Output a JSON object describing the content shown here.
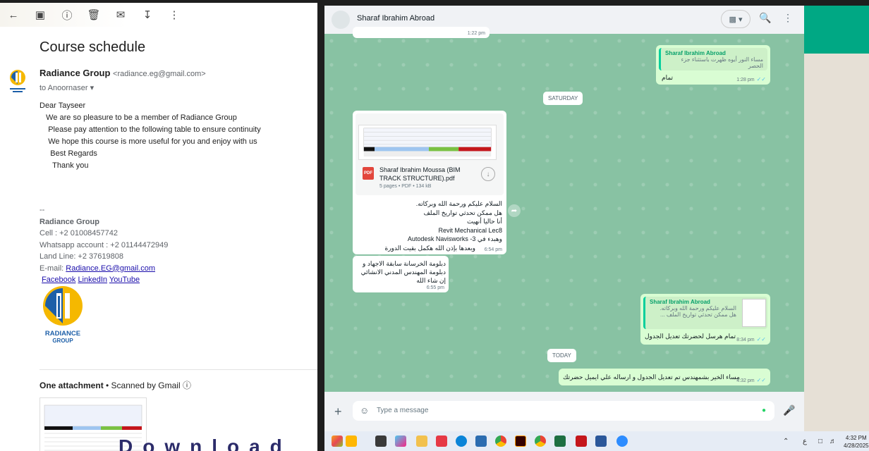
{
  "gmail": {
    "subject": "Course schedule",
    "sender_name": "Radiance Group",
    "sender_email": "<radiance.eg@gmail.com>",
    "to": "to Anoornaser",
    "body": [
      "Dear Tayseer",
      "",
      "   We are so pleasure to be a member of Radiance Group",
      "    Please pay attention to the following table to ensure continuity",
      "    We hope this course is more useful for you and enjoy with us",
      "",
      "     Best Regards",
      "      Thank you"
    ],
    "signature": {
      "dashes": "--",
      "name": "Radiance Group",
      "cell": "Cell : +2 01008457742",
      "whatsapp": "Whatsapp account : +2 01144472949",
      "landline": "Land Line: +2 37619808",
      "email_label": "E-mail: ",
      "email": "Radiance.EG@gmail.com",
      "links": [
        "Facebook",
        "LinkedIn",
        "YouTube"
      ]
    },
    "logo_text": [
      "RADIANCE",
      "GROUP"
    ],
    "attachment_title": "One attachment",
    "attachment_scanned": " • Scanned by Gmail",
    "download_text": "Download"
  },
  "whatsapp": {
    "contact_name": "Sharaf Ibrahim Abroad",
    "top_partial_time": "1:22 pm",
    "messages": {
      "m1": {
        "quote_name": "Sharaf Ibrahim Abroad",
        "quote_text": "مساء النور أيوه ظهرت باستثناء جزء الحصر",
        "text": "تمام",
        "time": "1:28 pm"
      },
      "day1": "SATURDAY",
      "pdf": {
        "name": "Sharaf Ibrahim Moussa (BIM TRACK STRUCTURE).pdf",
        "meta": "5 pages • PDF • 134 kB",
        "lines": [
          "السلام عليكم ورحمة الله وبركاته.",
          "هل ممكن تحدثي تواريخ الملف",
          "أنا حاليا أنهيت",
          "Revit Mechanical Lec8",
          "وهبدء في 3- Autodesk Navisworks",
          "وبعدها بإذن الله هكمل بقيت الدورة"
        ],
        "time": "6:54 pm"
      },
      "m2": {
        "lines": [
          "دبلومة الخرسانة سابقة الاجهاد و",
          "دبلومة المهندس المدني الانشائي",
          "إن شاء الله"
        ],
        "time": "6:55 pm"
      },
      "m3": {
        "quote_name": "Sharaf Ibrahim Abroad",
        "quote_lines": [
          "السلام عليكم ورحمة الله وبركاته.",
          "هل ممكن تحدثي تواريخ الملف ..."
        ],
        "text": "تمام هرسل لحضرتك تعديل الجدول",
        "time": "8:34 pm"
      },
      "day2": "TODAY",
      "m4": {
        "text": "مساء الخير بشمهندس تم تعديل الجدول و ارساله علي ايميل حضرتك",
        "time": "4:32 pm"
      }
    },
    "input_placeholder": "Type a message"
  },
  "taskbar": {
    "clock_time": "4:32 PM",
    "clock_date": "4/28/2025",
    "lang": "ع"
  },
  "colors": {
    "wa_chat_bg": "#88c2a3",
    "wa_out_bubble": "#d9fdd3",
    "wa_accent": "#00a884",
    "gmail_link": "#1a0dab"
  }
}
